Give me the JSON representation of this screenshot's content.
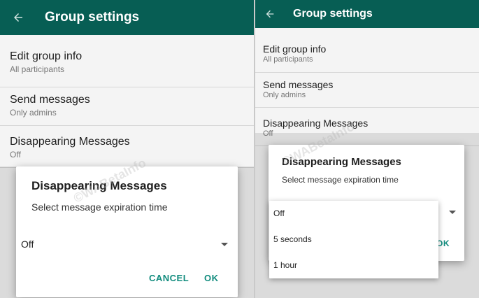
{
  "left": {
    "app_title": "Group settings",
    "settings": [
      {
        "title": "Edit group info",
        "subtitle": "All participants"
      },
      {
        "title": "Send messages",
        "subtitle": "Only admins"
      },
      {
        "title": "Disappearing Messages",
        "subtitle": "Off"
      }
    ],
    "dialog": {
      "title": "Disappearing Messages",
      "subtitle": "Select message expiration time",
      "selected_value": "Off",
      "cancel_label": "CANCEL",
      "ok_label": "OK"
    },
    "watermark": "©WABetaInfo"
  },
  "right": {
    "app_title": "Group settings",
    "settings": [
      {
        "title": "Edit group info",
        "subtitle": "All participants"
      },
      {
        "title": "Send messages",
        "subtitle": "Only admins"
      },
      {
        "title": "Disappearing Messages",
        "subtitle": "Off"
      }
    ],
    "dialog": {
      "title": "Disappearing Messages",
      "subtitle": "Select message expiration time",
      "ok_label": "OK"
    },
    "menu_options": [
      "Off",
      "5 seconds",
      "1 hour"
    ],
    "watermark": "©WABetaInfo"
  },
  "colors": {
    "app_bar": "#075e54",
    "accent": "#128c7e",
    "background": "#f4f4f4"
  },
  "icons": {
    "back": "arrow-left",
    "dropdown": "triangle-down"
  }
}
